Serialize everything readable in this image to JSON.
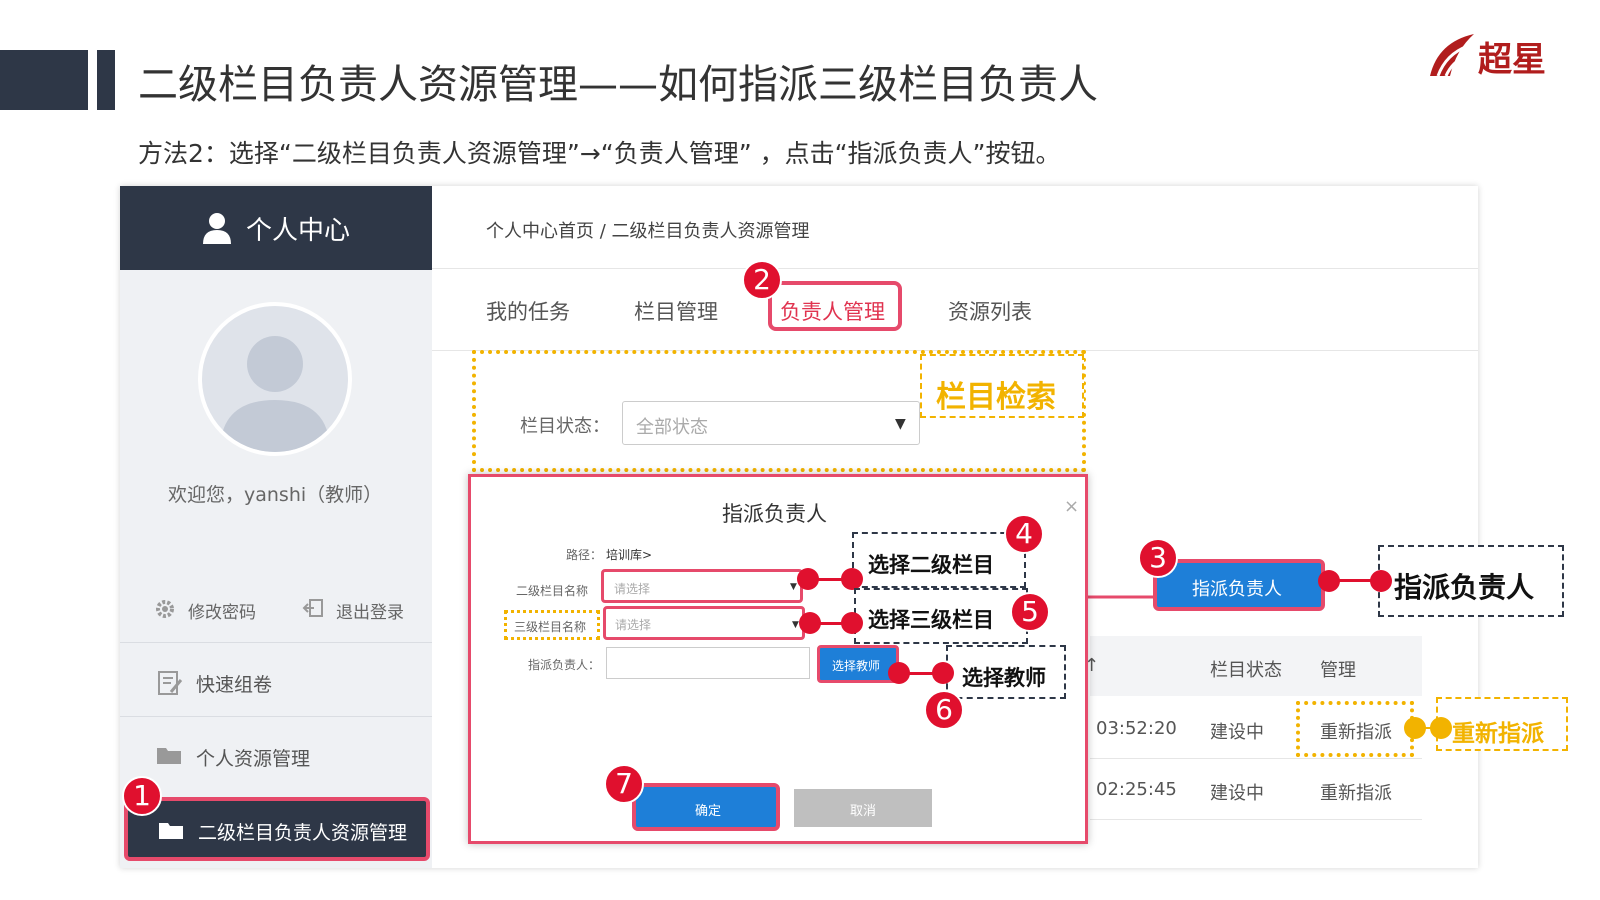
{
  "slide": {
    "title": "二级栏目负责人资源管理——如何指派三级栏目负责人",
    "subtitle": "方法2：选择“二级栏目负责人资源管理”→“负责人管理” ，点击“指派负责人”按钮。",
    "logo_text": "超星"
  },
  "sidebar": {
    "header": "个人中心",
    "welcome": "欢迎您，yanshi（教师）",
    "change_password": "修改密码",
    "logout": "退出登录",
    "items": [
      {
        "label": "快速组卷"
      },
      {
        "label": "个人资源管理"
      },
      {
        "label": "二级栏目负责人资源管理"
      }
    ]
  },
  "main": {
    "breadcrumb": "个人中心首页 / 二级栏目负责人资源管理",
    "tabs": [
      {
        "label": "我的任务"
      },
      {
        "label": "栏目管理"
      },
      {
        "label": "负责人管理"
      },
      {
        "label": "资源列表"
      }
    ],
    "search": {
      "status_label": "栏目状态：",
      "status_value": "全部状态",
      "annotation": "栏目检索"
    },
    "assign_button": "指派负责人",
    "table": {
      "headers": [
        "栏目状态",
        "管理"
      ],
      "rows": [
        {
          "time": "03:52:20",
          "status": "建设中",
          "action": "重新指派"
        },
        {
          "time": "02:25:45",
          "status": "建设中",
          "action": "重新指派"
        }
      ]
    }
  },
  "modal": {
    "title": "指派负责人",
    "close": "×",
    "path_label": "路径：",
    "path_value": "培训库>",
    "level2_label": "二级栏目名称",
    "level2_placeholder": "请选择",
    "level3_label": "三级栏目名称",
    "level3_placeholder": "请选择",
    "assignee_label": "指派负责人：",
    "select_teacher": "选择教师",
    "ok": "确定",
    "cancel": "取消"
  },
  "callouts": {
    "select_level2": "选择二级栏目",
    "select_level3": "选择三级栏目",
    "select_teacher": "选择教师",
    "assign": "指派负责人",
    "reassign": "重新指派"
  },
  "badges": [
    "1",
    "2",
    "3",
    "4",
    "5",
    "6",
    "7"
  ],
  "colors": {
    "accent_red": "#e64a6b",
    "highlight_yellow": "#f2b300",
    "primary_blue": "#1e7fd8",
    "dark": "#2e3747"
  }
}
